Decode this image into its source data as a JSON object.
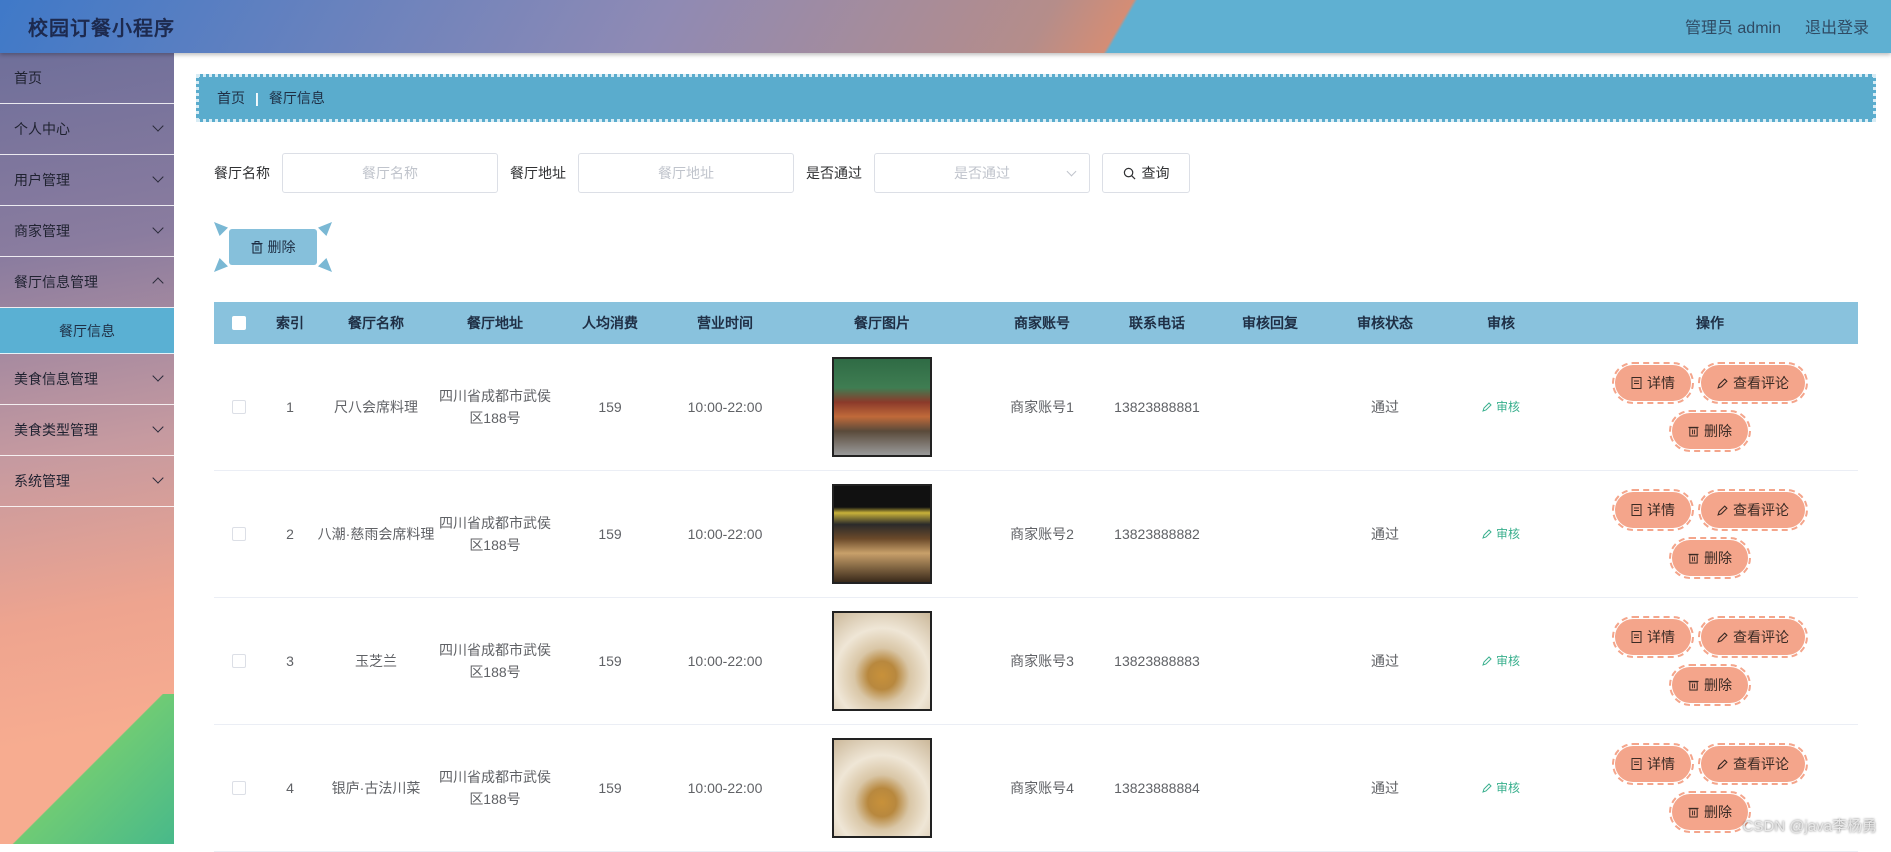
{
  "header": {
    "title": "校园订餐小程序",
    "user": "管理员 admin",
    "logout": "退出登录"
  },
  "sidebar": {
    "items": [
      {
        "label": "首页",
        "has_children": false
      },
      {
        "label": "个人中心",
        "has_children": true
      },
      {
        "label": "用户管理",
        "has_children": true
      },
      {
        "label": "商家管理",
        "has_children": true
      },
      {
        "label": "餐厅信息管理",
        "has_children": true
      },
      {
        "label": "美食信息管理",
        "has_children": true
      },
      {
        "label": "美食类型管理",
        "has_children": true
      },
      {
        "label": "系统管理",
        "has_children": true
      }
    ],
    "active_sub": "餐厅信息"
  },
  "breadcrumb": {
    "home": "首页",
    "current": "餐厅信息"
  },
  "search": {
    "name_label": "餐厅名称",
    "name_placeholder": "餐厅名称",
    "addr_label": "餐厅地址",
    "addr_placeholder": "餐厅地址",
    "pass_label": "是否通过",
    "pass_placeholder": "是否通过",
    "query_button": "查询"
  },
  "batch_delete": "删除",
  "table": {
    "headers": [
      "索引",
      "餐厅名称",
      "餐厅地址",
      "人均消费",
      "营业时间",
      "餐厅图片",
      "商家账号",
      "联系电话",
      "审核回复",
      "审核状态",
      "审核",
      "操作"
    ],
    "rows": [
      {
        "index": "1",
        "name": "尺八会席料理",
        "address": "四川省成都市武侯区188号",
        "avg": "159",
        "hours": "10:00-22:00",
        "account": "商家账号1",
        "phone": "13823888881",
        "reply": "",
        "status": "通过",
        "audit": "审核",
        "image": "storefront-green"
      },
      {
        "index": "2",
        "name": "八潮·慈雨会席料理",
        "address": "四川省成都市武侯区188号",
        "avg": "159",
        "hours": "10:00-22:00",
        "account": "商家账号2",
        "phone": "13823888882",
        "reply": "",
        "status": "通过",
        "audit": "审核",
        "image": "storefront-dark"
      },
      {
        "index": "3",
        "name": "玉芝兰",
        "address": "四川省成都市武侯区188号",
        "avg": "159",
        "hours": "10:00-22:00",
        "account": "商家账号3",
        "phone": "13823888883",
        "reply": "",
        "status": "通过",
        "audit": "审核",
        "image": "shop-interior"
      },
      {
        "index": "4",
        "name": "银庐·古法川菜",
        "address": "四川省成都市武侯区188号",
        "avg": "159",
        "hours": "10:00-22:00",
        "account": "商家账号4",
        "phone": "13823888884",
        "reply": "",
        "status": "通过",
        "audit": "审核",
        "image": "shop-interior"
      }
    ],
    "ops": {
      "detail": "详情",
      "comments": "查看评论",
      "delete": "删除"
    }
  },
  "watermark": "CSDN @java李杨勇",
  "colors": {
    "accent_blue": "#5aaccd",
    "header_row": "#89c2dd",
    "op_button": "#f4a58b",
    "audit_green": "#3ab08e"
  }
}
